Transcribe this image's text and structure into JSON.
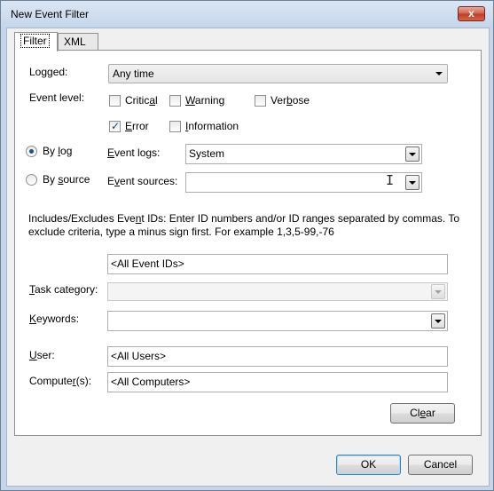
{
  "window": {
    "title": "New Event Filter",
    "close_glyph": "x"
  },
  "tabs": [
    {
      "label": "Filter",
      "active": true
    },
    {
      "label": "XML",
      "active": false
    }
  ],
  "logged": {
    "label": "Logged:",
    "value": "Any time"
  },
  "event_level": {
    "label": "Event level:",
    "options": [
      {
        "pre": "Critic",
        "u": "a",
        "post": "l",
        "checked": false
      },
      {
        "pre": "",
        "u": "W",
        "post": "arning",
        "checked": false
      },
      {
        "pre": "Ver",
        "u": "b",
        "post": "ose",
        "checked": false
      },
      {
        "pre": "",
        "u": "E",
        "post": "rror",
        "checked": true
      },
      {
        "pre": "",
        "u": "I",
        "post": "nformation",
        "checked": false
      }
    ]
  },
  "by_log": {
    "pre": "By ",
    "u": "l",
    "post": "og",
    "selected": true
  },
  "by_source": {
    "pre": "By ",
    "u": "s",
    "post": "ource",
    "selected": false
  },
  "event_logs": {
    "pre": "",
    "u": "E",
    "post": "vent logs:",
    "value": "System"
  },
  "event_sources": {
    "pre": "E",
    "u": "v",
    "post": "ent sources:",
    "value": ""
  },
  "event_ids": {
    "description_line1_pre": "Includes/Excludes Eve",
    "description_line1_u": "n",
    "description_line1_post": "t IDs: Enter ID numbers and/or ID ranges separated by commas. To",
    "description_line2": "exclude criteria, type a minus sign first. For example 1,3,5-99,-76",
    "value": "<All Event IDs>"
  },
  "task_category": {
    "pre": "",
    "u": "T",
    "post": "ask category:",
    "value": ""
  },
  "keywords": {
    "pre": "",
    "u": "K",
    "post": "eywords:",
    "value": ""
  },
  "user": {
    "pre": "",
    "u": "U",
    "post": "ser:",
    "value": "<All Users>"
  },
  "computers": {
    "pre": "Compute",
    "u": "r",
    "post": "(s):",
    "value": "<All Computers>"
  },
  "buttons": {
    "clear": {
      "pre": "Cl",
      "u": "e",
      "post": "ar"
    },
    "ok": "OK",
    "cancel": "Cancel"
  }
}
